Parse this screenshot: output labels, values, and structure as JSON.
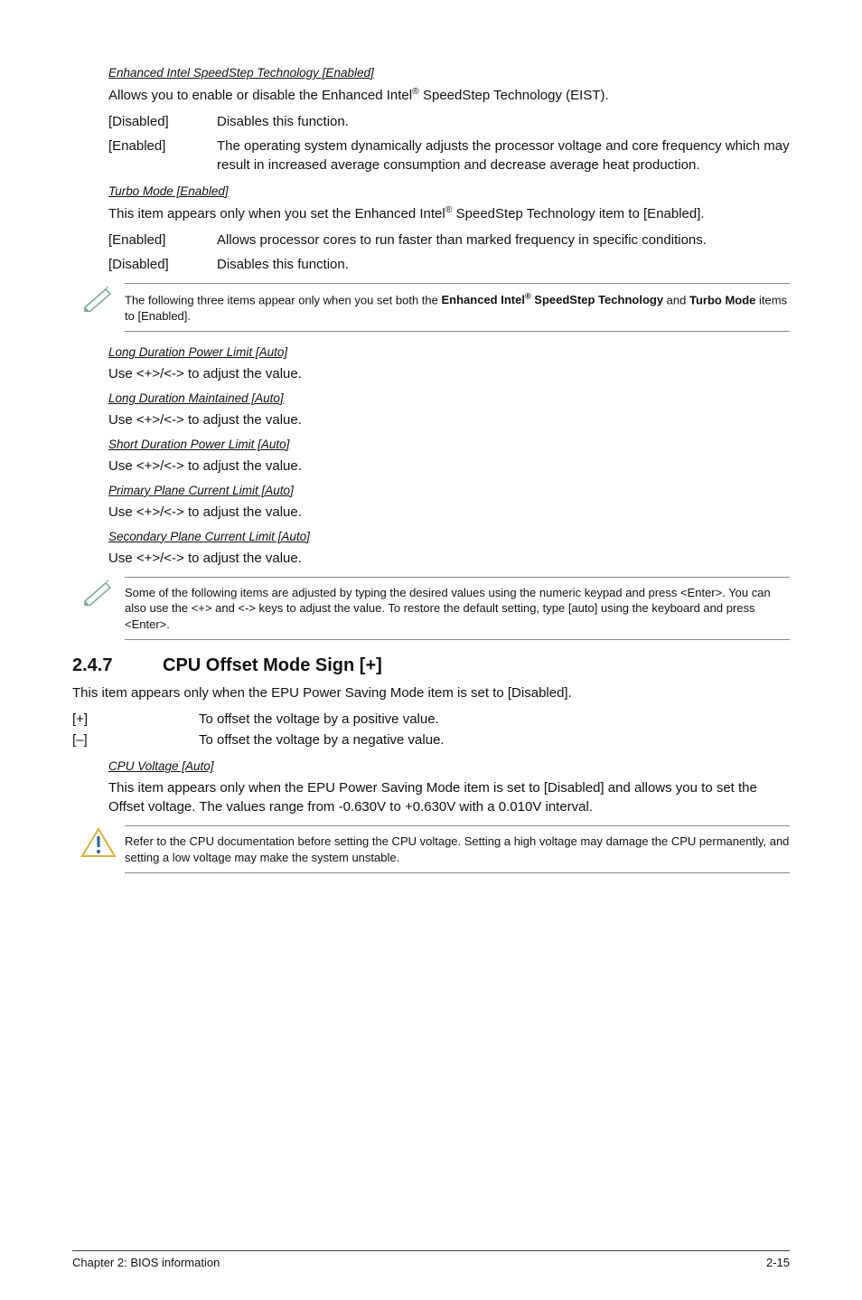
{
  "eist": {
    "heading": "Enhanced Intel SpeedStep Technology [Enabled]",
    "intro_pre": "Allows you to enable or disable the Enhanced Intel",
    "intro_post": " SpeedStep Technology (EIST).",
    "disabled_key": "[Disabled]",
    "disabled_val": "Disables this function.",
    "enabled_key": "[Enabled]",
    "enabled_val": "The operating system dynamically adjusts the processor voltage and core frequency which may result in increased average consumption and decrease average heat production."
  },
  "turbo": {
    "heading": "Turbo Mode [Enabled]",
    "intro_pre": "This item appears only when you set the Enhanced Intel",
    "intro_post": " SpeedStep Technology item to [Enabled].",
    "enabled_key": "[Enabled]",
    "enabled_val": "Allows processor cores to run faster than marked frequency in specific conditions.",
    "disabled_key": "[Disabled]",
    "disabled_val": "Disables this function."
  },
  "note1_pre": "The following three items appear only when you set both the ",
  "note1_bold1": "Enhanced Intel",
  "note1_mid": " SpeedStep Technology",
  "note1_and": " and ",
  "note1_bold2": "Turbo Mode",
  "note1_post": " items to [Enabled].",
  "limits": {
    "long_power_h": "Long Duration Power Limit [Auto]",
    "long_power_t": "Use <+>/<-> to adjust the value.",
    "long_maint_h": "Long Duration Maintained [Auto]",
    "long_maint_t": "Use <+>/<-> to adjust the value.",
    "short_power_h": "Short Duration Power Limit [Auto]",
    "short_power_t": "Use <+>/<-> to adjust the value.",
    "primary_h": "Primary Plane Current Limit [Auto]",
    "primary_t": "Use <+>/<-> to adjust the value.",
    "secondary_h": "Secondary Plane Current Limit [Auto]",
    "secondary_t": "Use <+>/<-> to adjust the value."
  },
  "note2": "Some of the following items are adjusted by typing the desired values using the numeric keypad and press <Enter>. You can also use the <+> and <-> keys to adjust the value. To restore the default setting, type [auto] using the keyboard and press <Enter>.",
  "sec247": {
    "num": "2.4.7",
    "title": "CPU Offset Mode Sign [+]",
    "intro": "This item appears only when the EPU Power Saving Mode item is set to [Disabled].",
    "plus_key": "[+]",
    "plus_val": "To offset the voltage by a positive value.",
    "minus_key": "[–]",
    "minus_val": "To offset the voltage by a negative value.",
    "cpuv_h": "CPU Voltage [Auto]",
    "cpuv_t": "This item appears only when the EPU Power Saving Mode item is set to [Disabled] and allows you to set the Offset voltage. The values range from -0.630V to +0.630V with a 0.010V interval."
  },
  "caution": "Refer to the CPU documentation before setting the CPU voltage. Setting a high voltage may damage the CPU permanently, and setting a low voltage may make the system unstable.",
  "footer_left": "Chapter 2: BIOS information",
  "footer_right": "2-15"
}
